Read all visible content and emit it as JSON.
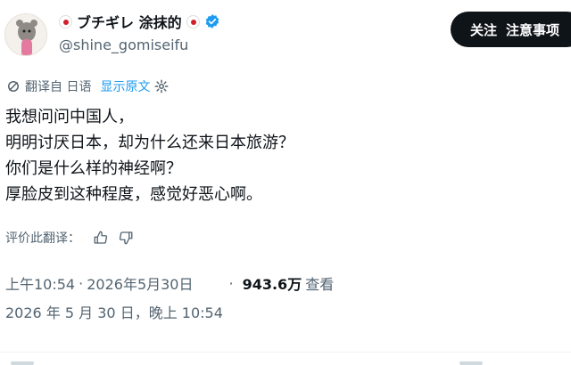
{
  "author": {
    "display_name": "ブチギレ 涂抹的",
    "handle": "@shine_gomiseifu",
    "verified": true,
    "flag_icon": "japan-flag-icon",
    "verified_color": "#1d9bf0"
  },
  "actions": {
    "follow_label": "关注",
    "notice_label": "注意事项"
  },
  "translation": {
    "translated_from": "翻译自 日语",
    "show_original": "显示原文"
  },
  "tweet": {
    "lines": [
      "我想问问中国人，",
      "明明讨厌日本，却为什么还来日本旅游？",
      "你们是什么样的神经啊？",
      "厚脸皮到这种程度，感觉好恶心啊。"
    ]
  },
  "rate_translation": {
    "label": "评价此翻译："
  },
  "meta": {
    "time": "上午10:54",
    "separator": "·",
    "date": "2026年5月30日",
    "views_count": "943.6万",
    "views_label": "查看",
    "local_time": "2026 年 5 月 30 日，晚上 10:54"
  },
  "colors": {
    "text_primary": "#0f1419",
    "text_secondary": "#536471",
    "link": "#1d9bf0",
    "button_bg": "#0f1419"
  }
}
